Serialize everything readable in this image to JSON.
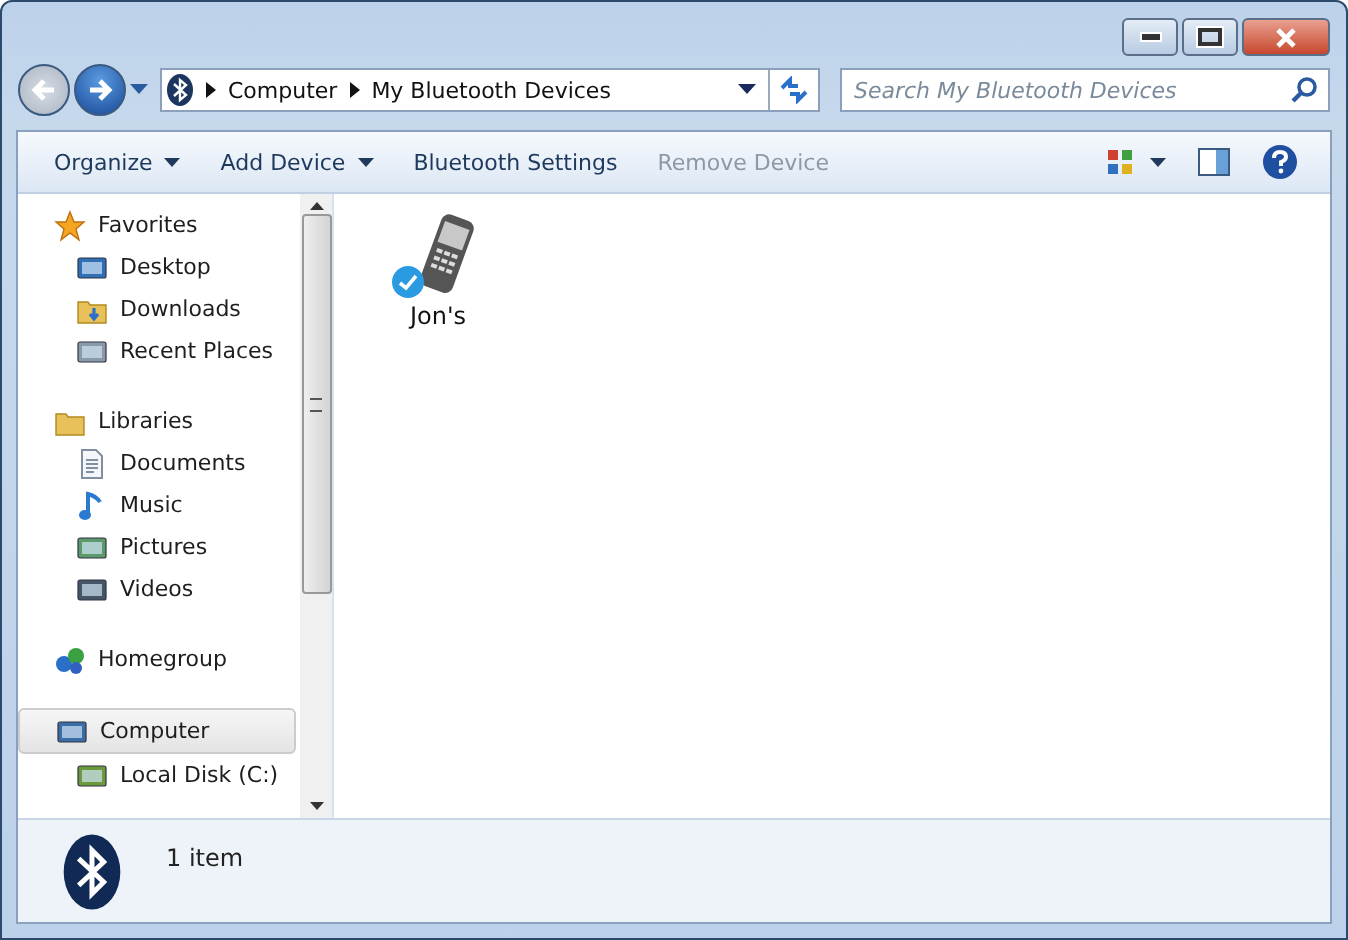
{
  "address_bar": {
    "segments": [
      "Computer",
      "My Bluetooth Devices"
    ]
  },
  "search": {
    "placeholder": "Search My Bluetooth Devices"
  },
  "toolbar": [
    {
      "label": "Organize",
      "dropdown": true,
      "disabled": false
    },
    {
      "label": "Add Device",
      "dropdown": true,
      "disabled": false
    },
    {
      "label": "Bluetooth Settings",
      "dropdown": false,
      "disabled": false
    },
    {
      "label": "Remove Device",
      "dropdown": false,
      "disabled": true
    }
  ],
  "navigation": [
    {
      "label": "Favorites",
      "selected": false,
      "children": [
        {
          "label": "Desktop"
        },
        {
          "label": "Downloads"
        },
        {
          "label": "Recent Places"
        }
      ]
    },
    {
      "label": "Libraries",
      "selected": false,
      "children": [
        {
          "label": "Documents"
        },
        {
          "label": "Music"
        },
        {
          "label": "Pictures"
        },
        {
          "label": "Videos"
        }
      ]
    },
    {
      "label": "Homegroup",
      "selected": false
    },
    {
      "label": "Computer",
      "selected": true,
      "children": [
        {
          "label": "Local Disk (C:)"
        }
      ]
    }
  ],
  "devices": [
    {
      "name": "Jon's",
      "connected": true
    }
  ],
  "status_bar": {
    "text": "1 item"
  }
}
